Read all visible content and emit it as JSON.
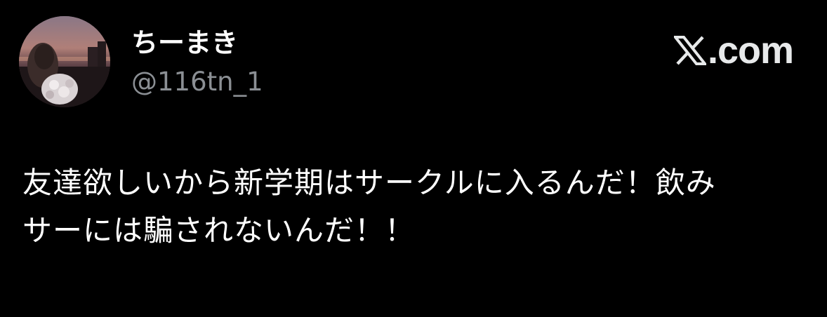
{
  "user": {
    "display_name": "ちーまき",
    "handle": "@116tn_1",
    "avatar_icon": "profile-photo"
  },
  "brand": {
    "logo_icon": "x-logo-icon",
    "text": ".com"
  },
  "tweet": {
    "line1": "友達欲しいから新学期はサークルに入るんだ！飲み",
    "line2": "サーには騙されないんだ！！"
  },
  "colors": {
    "background": "#000000",
    "text": "#ffffff",
    "handle": "#8b8f94"
  }
}
